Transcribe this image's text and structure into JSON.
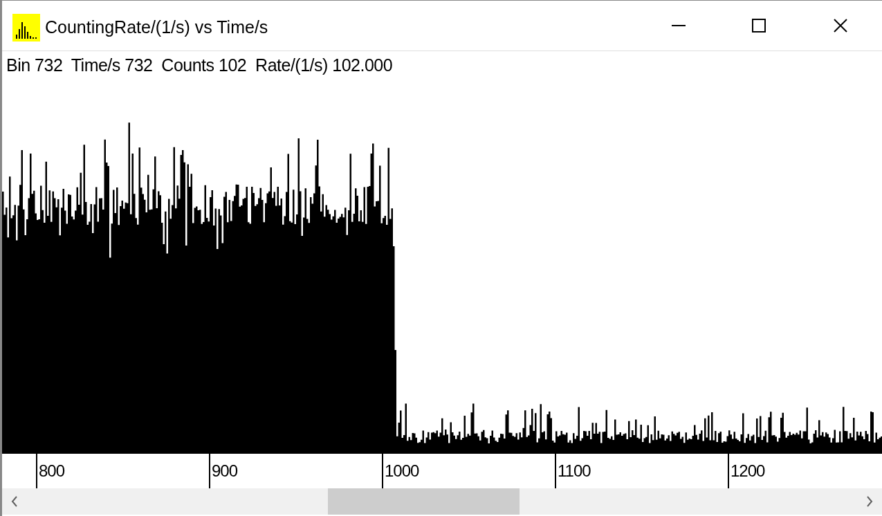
{
  "window": {
    "title": "CountingRate/(1/s) vs Time/s"
  },
  "status_line": "Bin 732  Time/s 732  Counts 102  Rate/(1/s) 102.000",
  "x_axis_labels": [
    "800",
    "900",
    "1000",
    "1100",
    "1200"
  ]
}
